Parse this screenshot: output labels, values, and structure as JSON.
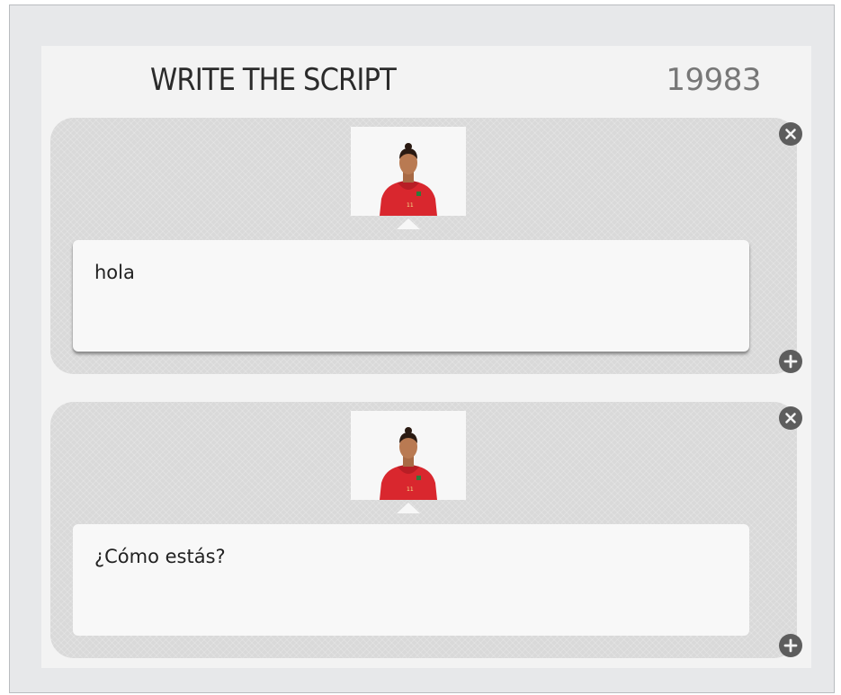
{
  "header": {
    "title": "WRITE THE SCRIPT",
    "score": "19983"
  },
  "cards": [
    {
      "avatar_icon": "soccer-player-red-jersey",
      "text": "hola",
      "close_icon": "close-icon",
      "add_icon": "plus-icon"
    },
    {
      "avatar_icon": "soccer-player-red-jersey",
      "text": "¿Cómo estás?",
      "close_icon": "close-icon",
      "add_icon": "plus-icon"
    }
  ],
  "colors": {
    "background": "#e7e8ea",
    "panel": "#f3f3f3",
    "card": "#d9d9d9",
    "button": "#5d5d5d",
    "jersey": "#d9272e"
  }
}
